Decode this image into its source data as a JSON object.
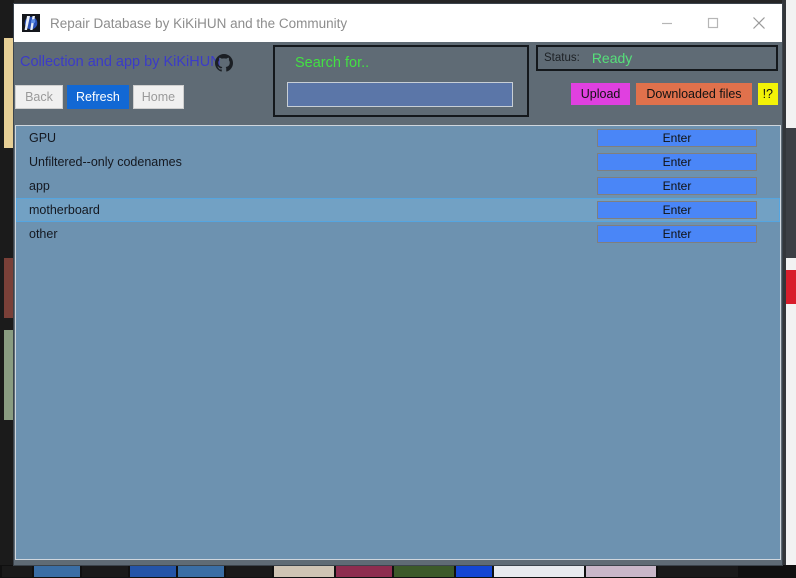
{
  "window": {
    "title": "Repair Database by KiKiHUN and the Community",
    "icon": "app-icon",
    "controls": [
      {
        "name": "minimize",
        "glyph": "minimize-icon"
      },
      {
        "name": "maximize",
        "glyph": "maximize-icon"
      },
      {
        "name": "close",
        "glyph": "close-icon"
      }
    ]
  },
  "header": {
    "collection_label": "Collection and app by KiKiHUN",
    "github_icon": "github-icon",
    "nav": [
      {
        "label": "Back",
        "state": "disabled"
      },
      {
        "label": "Refresh",
        "state": "active"
      },
      {
        "label": "Home",
        "state": "disabled"
      }
    ],
    "search": {
      "label": "Search for..",
      "value": "",
      "placeholder": ""
    },
    "status": {
      "caption": "Status:",
      "value": "Ready",
      "value_color": "#56e07a"
    },
    "actions": [
      {
        "label": "Upload",
        "color": "#e040e0"
      },
      {
        "label": "Downloaded files",
        "color": "#e0714c"
      },
      {
        "label": "!?",
        "color": "#f3f307"
      }
    ]
  },
  "list": {
    "enter_label": "Enter",
    "rows": [
      {
        "label": "GPU",
        "selected": false
      },
      {
        "label": "Unfiltered--only codenames",
        "selected": false
      },
      {
        "label": "app",
        "selected": false
      },
      {
        "label": "motherboard",
        "selected": true
      },
      {
        "label": "other",
        "selected": false
      }
    ]
  },
  "colors": {
    "form_background": "#5f6b75",
    "list_background": "#6d92b0",
    "list_selected": "#72a1c4",
    "search_input": "#5b76a8",
    "enter_button": "#4a86f7",
    "link_text": "#3b3bc8",
    "search_label": "#43e043"
  },
  "taskbar": {
    "items": [
      "explorer",
      "browser",
      "browser",
      "editor",
      "image",
      "image",
      "media",
      "chat",
      "tray"
    ]
  }
}
